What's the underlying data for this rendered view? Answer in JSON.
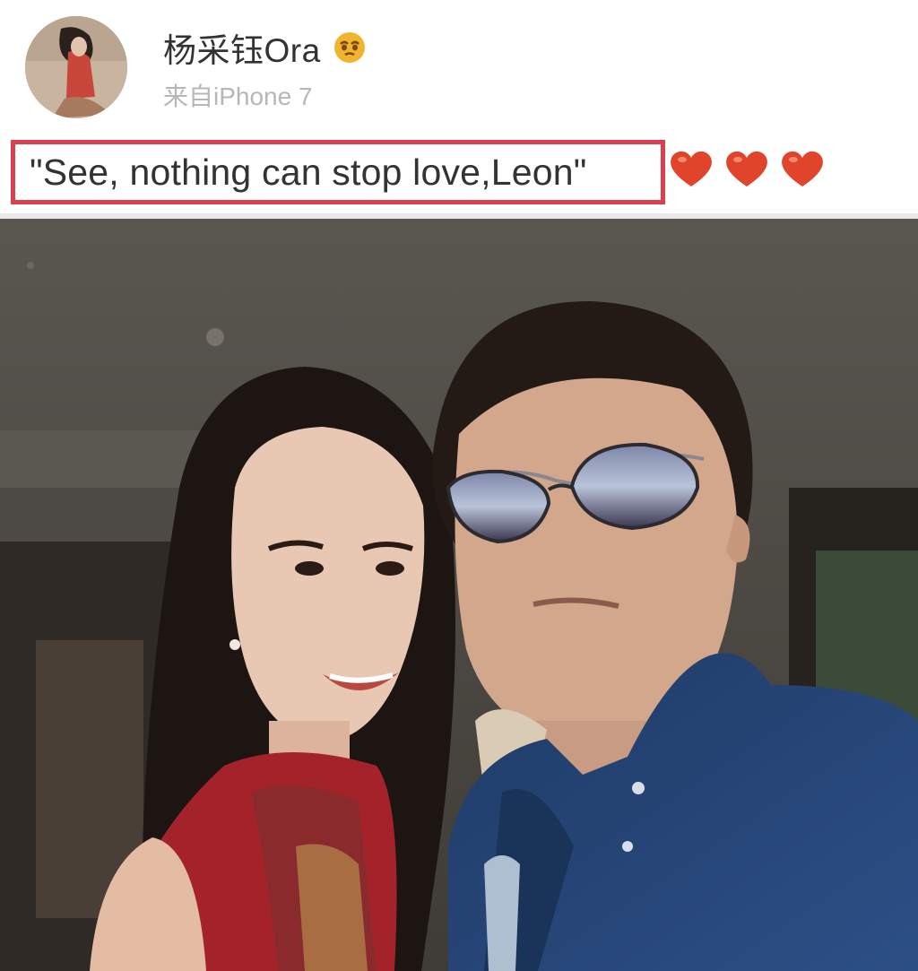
{
  "post": {
    "author": {
      "name": "杨采钰Ora",
      "badge_icon": "gold-emoji-badge-icon",
      "avatar": "profile-avatar"
    },
    "source_text": "来自iPhone 7",
    "caption": "\"See, nothing can stop love,Leon\"",
    "hearts": [
      "red-heart-icon",
      "red-heart-icon",
      "red-heart-icon"
    ],
    "highlight_color": "#d9414e",
    "heart_color": "#e0452c"
  },
  "photo": {
    "description_icon": "selfie-photo"
  }
}
